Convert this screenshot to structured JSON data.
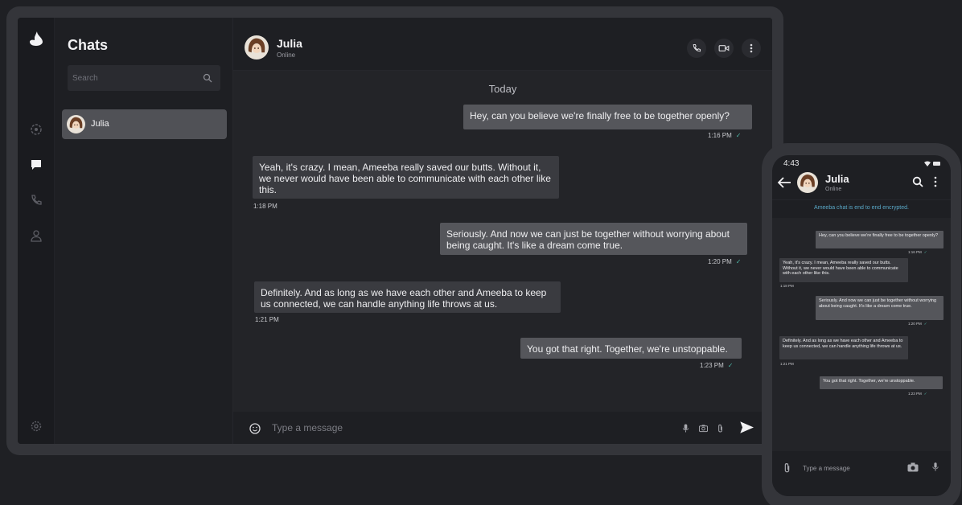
{
  "desktop": {
    "app_title": "Chats",
    "search_placeholder": "Search",
    "contacts": [
      {
        "name": "Julia"
      }
    ],
    "contact": {
      "name": "Julia",
      "status": "Online"
    },
    "day_label": "Today",
    "messages": [
      {
        "dir": "out",
        "text": "Hey, can you believe we're finally free to be together openly?",
        "time": "1:16 PM",
        "read": "✓"
      },
      {
        "dir": "in",
        "text": "Yeah, it's crazy. I mean, Ameeba really saved our butts. Without it, we never would have been able to communicate with each other like this.",
        "time": "1:18 PM"
      },
      {
        "dir": "out",
        "text": "Seriously. And now we can just be together without worrying about being caught. It's like a dream come true.",
        "time": "1:20 PM",
        "read": "✓"
      },
      {
        "dir": "in",
        "text": "Definitely. And as long as we have each other and Ameeba to keep us connected, we can handle anything life throws at us.",
        "time": "1:21 PM"
      },
      {
        "dir": "out",
        "text": "You got that right. Together, we're unstoppable.",
        "time": "1:23 PM",
        "read": "✓"
      }
    ],
    "composer_placeholder": "Type a message"
  },
  "phone": {
    "clock": "4:43",
    "contact": {
      "name": "Julia",
      "status": "Online"
    },
    "encryption_notice": "Ameeba chat is end to end encrypted.",
    "messages": [
      {
        "dir": "out",
        "text": "Hey, can you believe we're finally free to be together openly?",
        "time": "1:16 PM",
        "read": "✓"
      },
      {
        "dir": "in",
        "text": "Yeah, it's crazy. I mean, Ameeba really saved our butts. Without it, we never would have been able to communicate with each other like this.",
        "time": "1:18 PM"
      },
      {
        "dir": "out",
        "text": "Seriously. And now we can just be together without worrying about being caught. It's like a dream come true.",
        "time": "1:20 PM",
        "read": "✓"
      },
      {
        "dir": "in",
        "text": "Definitely. And as long as we have each other and Ameeba to keep us connected, we can handle anything life throws at us.",
        "time": "1:21 PM"
      },
      {
        "dir": "out",
        "text": "You got that right. Together, we're unstoppable.",
        "time": "1:23 PM",
        "read": "✓"
      }
    ],
    "composer_placeholder": "Type a message"
  },
  "icons": {
    "rail": [
      "app-logo-icon",
      "status-icon",
      "chat-icon",
      "call-icon",
      "contacts-icon",
      "settings-icon"
    ],
    "header": [
      "phone-icon",
      "video-icon",
      "more-icon"
    ],
    "composer": [
      "emoji-icon",
      "mic-icon",
      "camera-icon",
      "attach-icon",
      "send-icon"
    ]
  },
  "colors": {
    "background": "#1f2024",
    "outgoing_bubble": "#55565b",
    "incoming_bubble": "#3a3b40",
    "read_tick": "#4fb5a6",
    "encryption_text": "#5aa9c8"
  }
}
